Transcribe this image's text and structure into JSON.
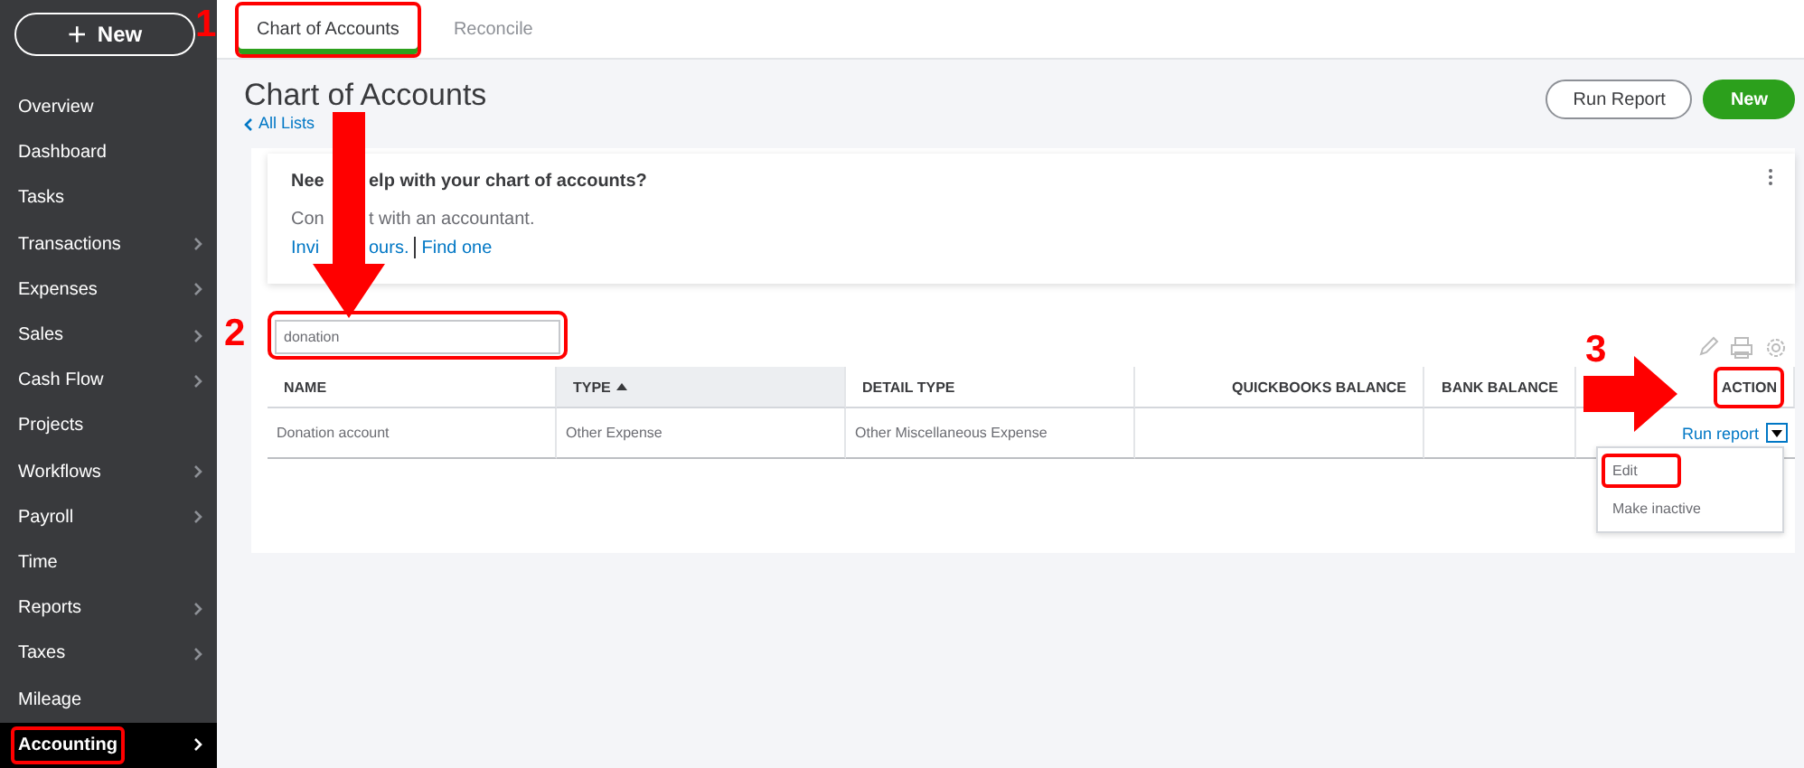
{
  "sidebar": {
    "new_button": {
      "icon": "+",
      "label": "New"
    },
    "items": [
      {
        "label": "Overview",
        "has_submenu": false,
        "selected": false,
        "highlighted": false
      },
      {
        "label": "Dashboard",
        "has_submenu": false,
        "selected": false,
        "highlighted": false
      },
      {
        "label": "Tasks",
        "has_submenu": false,
        "selected": false,
        "highlighted": false
      },
      {
        "label": "Transactions",
        "has_submenu": true,
        "selected": false,
        "highlighted": false
      },
      {
        "label": "Expenses",
        "has_submenu": true,
        "selected": false,
        "highlighted": false
      },
      {
        "label": "Sales",
        "has_submenu": true,
        "selected": false,
        "highlighted": false
      },
      {
        "label": "Cash Flow",
        "has_submenu": true,
        "selected": false,
        "highlighted": false
      },
      {
        "label": "Projects",
        "has_submenu": false,
        "selected": false,
        "highlighted": false
      },
      {
        "label": "Workflows",
        "has_submenu": true,
        "selected": false,
        "highlighted": false
      },
      {
        "label": "Payroll",
        "has_submenu": true,
        "selected": false,
        "highlighted": false
      },
      {
        "label": "Time",
        "has_submenu": false,
        "selected": false,
        "highlighted": false
      },
      {
        "label": "Reports",
        "has_submenu": true,
        "selected": false,
        "highlighted": false
      },
      {
        "label": "Taxes",
        "has_submenu": true,
        "selected": false,
        "highlighted": false
      },
      {
        "label": "Mileage",
        "has_submenu": false,
        "selected": false,
        "highlighted": false
      },
      {
        "label": "Accounting",
        "has_submenu": true,
        "selected": true,
        "highlighted": true
      }
    ]
  },
  "tabs": [
    {
      "label": "Chart of Accounts",
      "selected": true,
      "highlighted": true
    },
    {
      "label": "Reconcile",
      "selected": false,
      "highlighted": false
    }
  ],
  "page": {
    "title": "Chart of Accounts",
    "back_link": "All Lists",
    "buttons": [
      {
        "label": "Run Report",
        "kind": "secondary"
      },
      {
        "label": "New",
        "kind": "primary"
      }
    ]
  },
  "help_card": {
    "title_parts": [
      "Nee",
      "elp with your chart of accounts?"
    ],
    "text_parts": [
      "Con",
      "t with an accountant."
    ],
    "links": [
      {
        "parts": [
          "Invi",
          "ours."
        ]
      },
      {
        "parts": [
          "Find one"
        ]
      }
    ]
  },
  "search": {
    "value": "donation",
    "highlighted": true
  },
  "table": {
    "columns": [
      {
        "label": "NAME",
        "sorted": false,
        "highlighted": false
      },
      {
        "label": "TYPE",
        "sorted": true,
        "highlighted": false
      },
      {
        "label": "DETAIL TYPE",
        "sorted": false,
        "highlighted": false
      },
      {
        "label": "QUICKBOOKS BALANCE",
        "sorted": false,
        "highlighted": false
      },
      {
        "label": "BANK BALANCE",
        "sorted": false,
        "highlighted": false
      },
      {
        "label": "ACTION",
        "sorted": false,
        "highlighted": true
      }
    ],
    "rows": [
      {
        "cells": [
          "Donation account",
          "Other Expense",
          "Other Miscellaneous Expense",
          "",
          ""
        ],
        "action": "Run report"
      }
    ]
  },
  "action_menu": {
    "open": true,
    "items": [
      {
        "label": "Edit",
        "highlighted": true
      },
      {
        "label": "Make inactive",
        "highlighted": false
      }
    ]
  },
  "annotations": [
    {
      "label": "1"
    },
    {
      "label": "2"
    },
    {
      "label": "3"
    }
  ]
}
